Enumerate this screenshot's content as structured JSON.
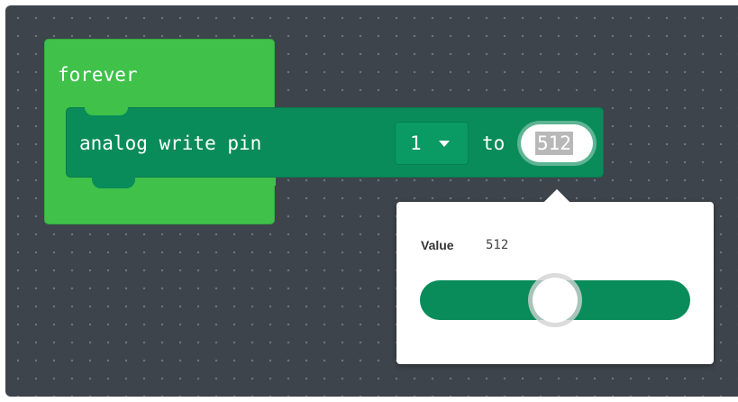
{
  "workspace": {
    "background_color": "#3e444b"
  },
  "blocks": {
    "forever": {
      "label": "forever",
      "color": "#3fc14a"
    },
    "analog_write": {
      "label": "analog write pin",
      "pin_dropdown_value": "1",
      "to_label": "to",
      "value": "512",
      "color": "#098c5a"
    }
  },
  "popover": {
    "label": "Value",
    "value": "512",
    "slider": {
      "min": 0,
      "max": 1023,
      "value": 512,
      "fraction": 0.5
    }
  },
  "icons": {
    "dropdown": "caret-down-icon"
  }
}
